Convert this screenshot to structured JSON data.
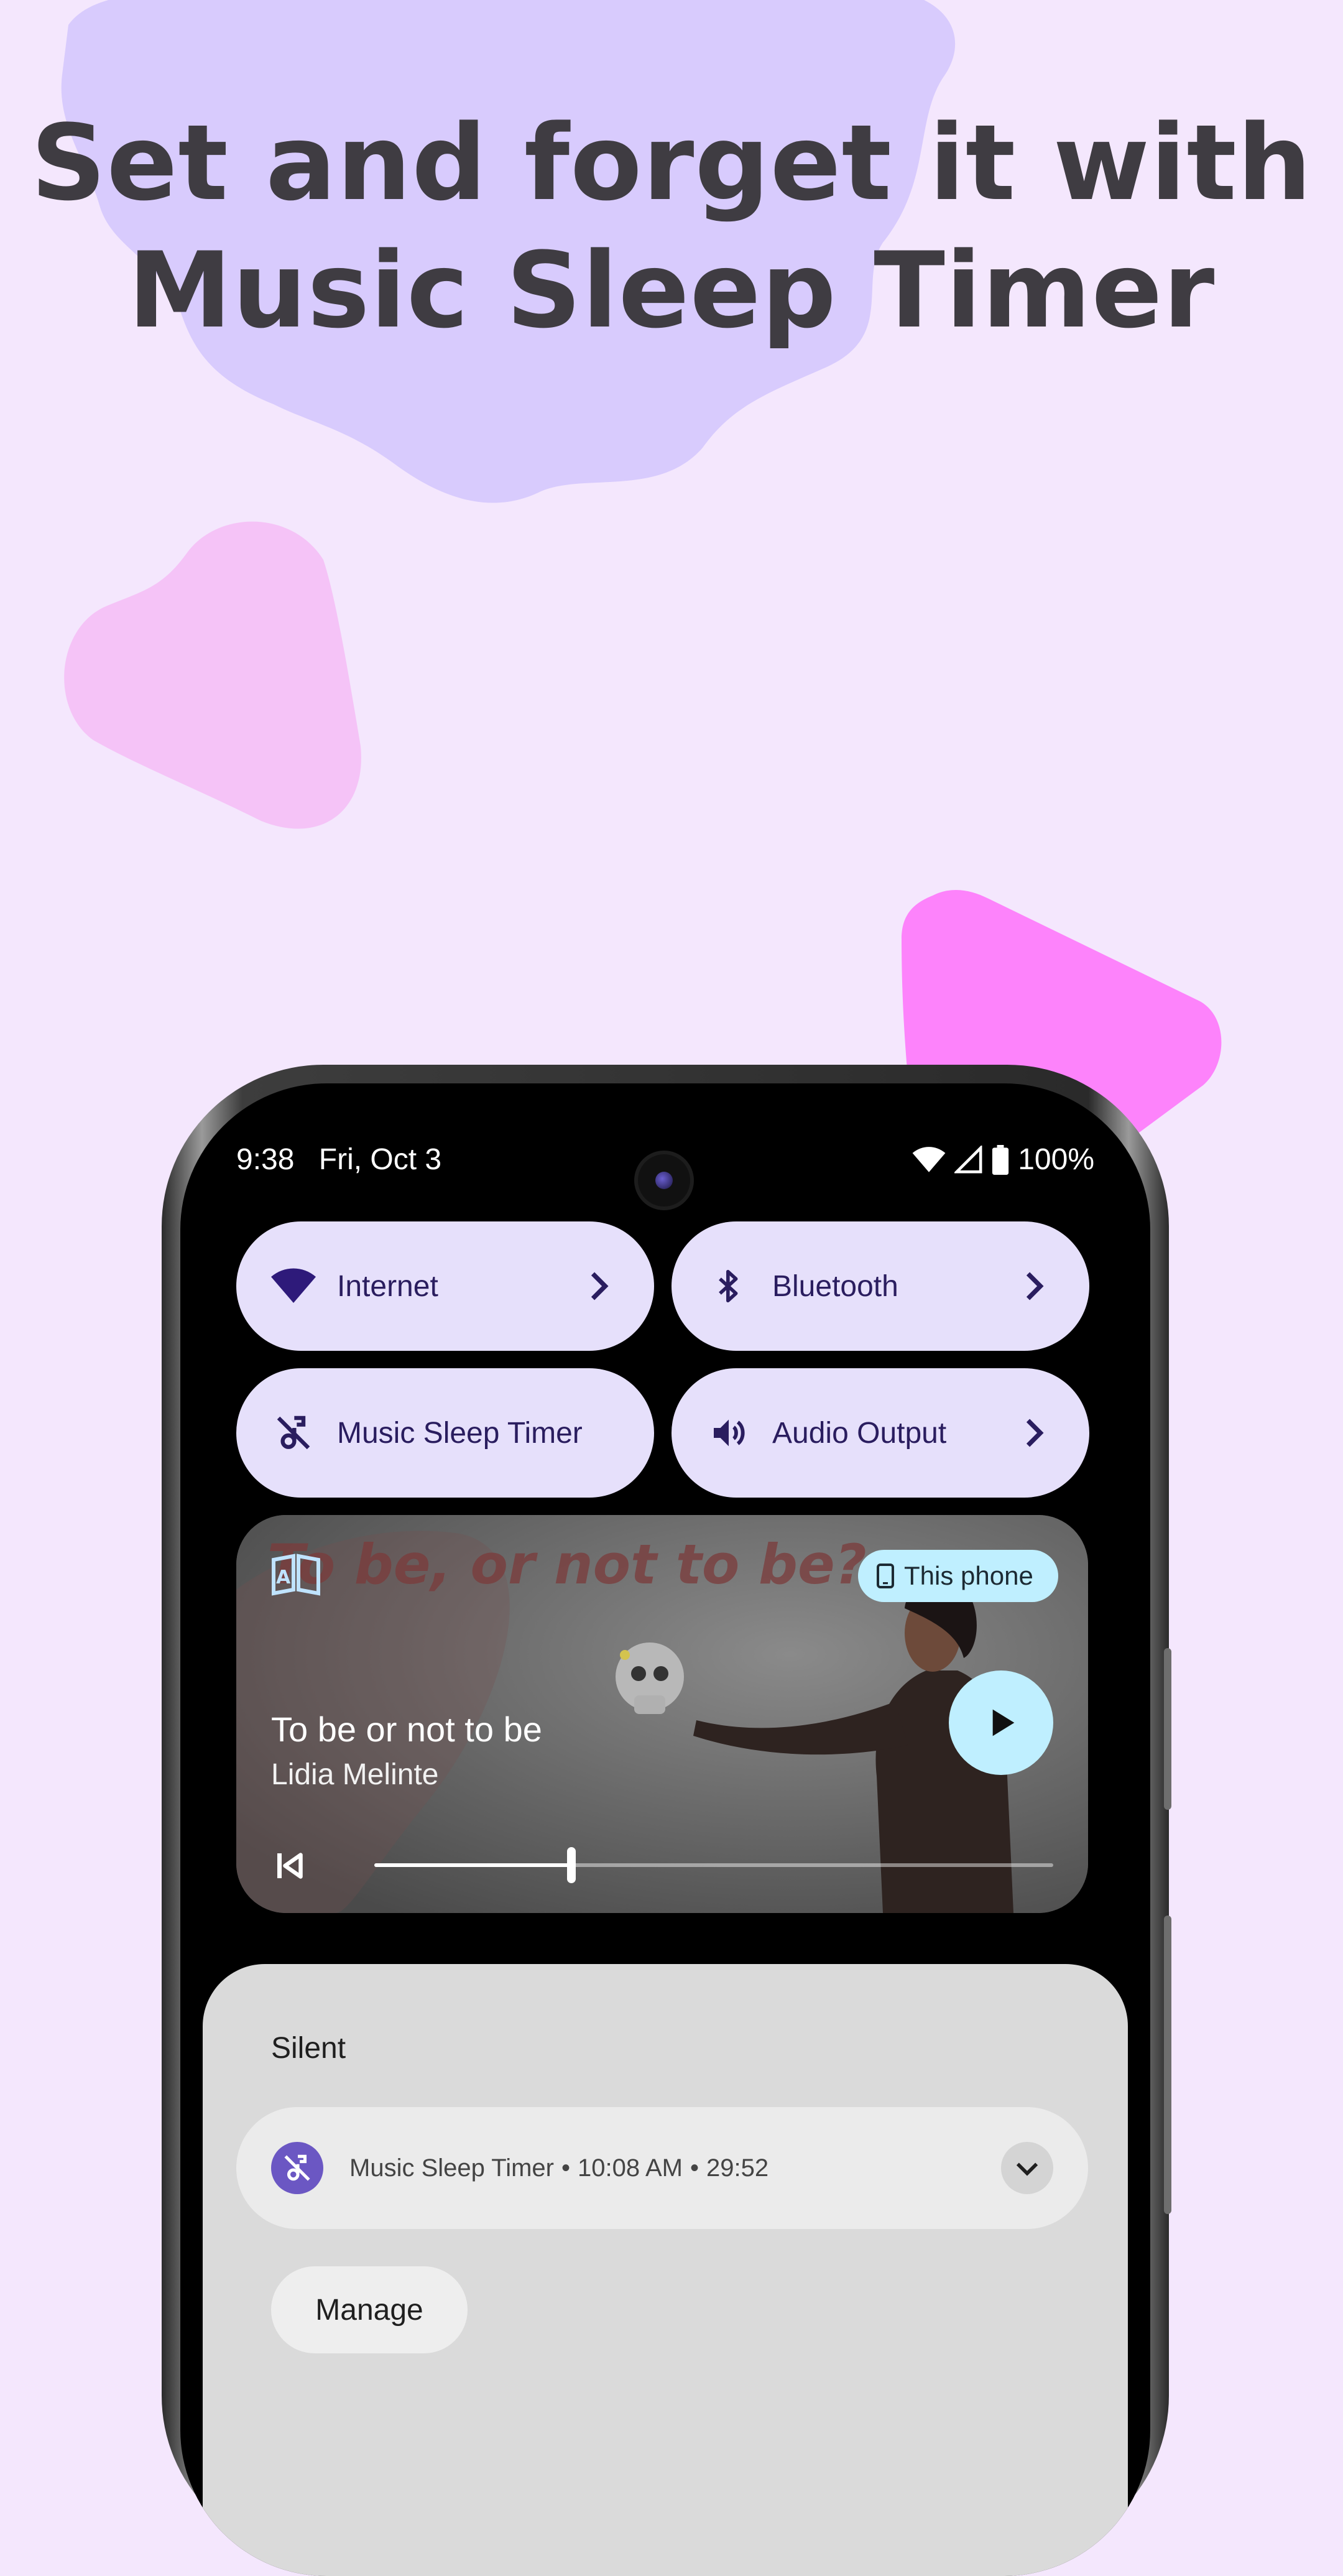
{
  "headline": {
    "line1": "Set and forget it with",
    "line2": "Music Sleep Timer"
  },
  "statusbar": {
    "time": "9:38",
    "date": "Fri, Oct 3",
    "battery": "100%"
  },
  "tiles": [
    {
      "label": "Internet",
      "icon": "wifi-icon",
      "has_chevron": true
    },
    {
      "label": "Bluetooth",
      "icon": "bluetooth-icon",
      "has_chevron": true
    },
    {
      "label": "Music Sleep Timer",
      "icon": "music-off-icon",
      "has_chevron": false
    },
    {
      "label": "Audio Output",
      "icon": "volume-icon",
      "has_chevron": true
    }
  ],
  "media": {
    "artwork_text": "To be, or not to be?",
    "title": "To be or not to be",
    "artist": "Lidia Melinte",
    "output_device": "This phone",
    "progress": 0.29
  },
  "notifications": {
    "section_label": "Silent",
    "item": {
      "app": "Music Sleep Timer",
      "time": "10:08 AM",
      "remaining": "29:52"
    },
    "manage_label": "Manage"
  },
  "colors": {
    "background": "#f4e7fd",
    "blob_purple": "#d8cbfd",
    "blob_pink": "#f5c3f7",
    "triangle_magenta": "#fd83fb",
    "tile_bg": "#e6e0fb",
    "chip_bg": "#bfefff",
    "accent": "#6b57c3"
  }
}
